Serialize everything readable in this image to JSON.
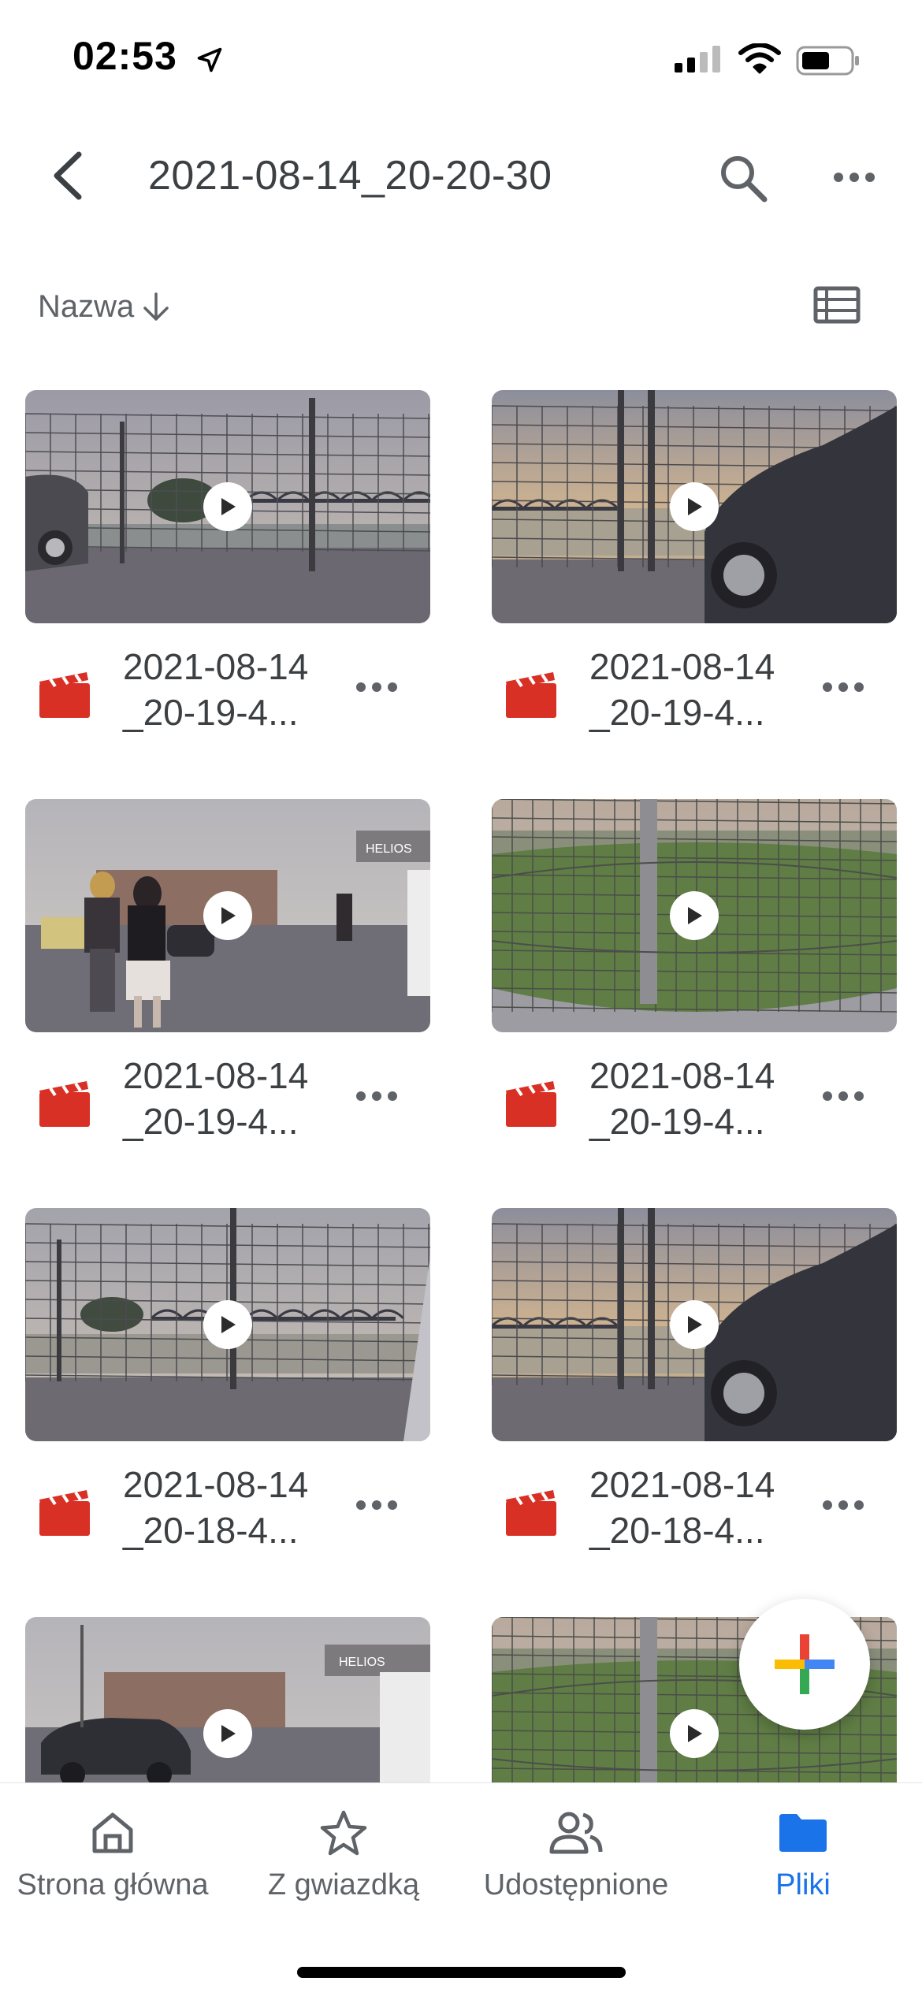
{
  "status_bar": {
    "time": "02:53"
  },
  "header": {
    "title": "2021-08-14_20-20-30"
  },
  "sort": {
    "label": "Nazwa"
  },
  "files": [
    {
      "name_line1": "2021-08-14",
      "name_line2": "_20-19-4...",
      "scene": "fence-car-left"
    },
    {
      "name_line1": "2021-08-14",
      "name_line2": "_20-19-4...",
      "scene": "fence-car-right"
    },
    {
      "name_line1": "2021-08-14",
      "name_line2": "_20-19-4...",
      "scene": "street-people"
    },
    {
      "name_line1": "2021-08-14",
      "name_line2": "_20-19-4...",
      "scene": "grass-fence"
    },
    {
      "name_line1": "2021-08-14",
      "name_line2": "_20-18-4...",
      "scene": "fence-river"
    },
    {
      "name_line1": "2021-08-14",
      "name_line2": "_20-18-4...",
      "scene": "fence-car-right"
    },
    {
      "name_line1": "",
      "name_line2": "",
      "scene": "street-car"
    },
    {
      "name_line1": "",
      "name_line2": "",
      "scene": "grass-fence"
    }
  ],
  "bottom_nav": {
    "items": [
      {
        "label": "Strona główna",
        "icon": "home-icon"
      },
      {
        "label": "Z gwiazdką",
        "icon": "star-icon"
      },
      {
        "label": "Udostępnione",
        "icon": "shared-people-icon"
      },
      {
        "label": "Pliki",
        "icon": "folder-icon",
        "active": true
      }
    ]
  },
  "colors": {
    "accent": "#1a73e8",
    "video_icon": "#d93025",
    "text": "#3c4043"
  }
}
